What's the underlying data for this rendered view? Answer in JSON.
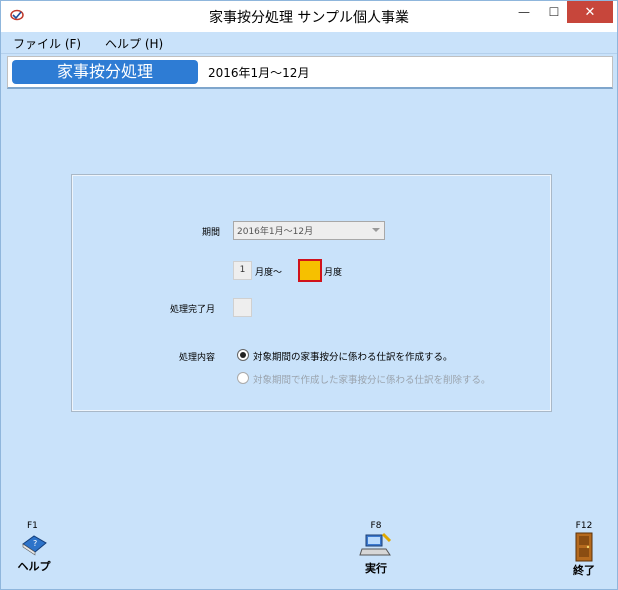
{
  "window": {
    "title": "家事按分処理 サンプル個人事業",
    "controls": {
      "minimize": "—",
      "maximize": "☐",
      "close": "✕"
    }
  },
  "menu": {
    "file": "ファイル (F)",
    "help": "ヘルプ (H)"
  },
  "header": {
    "title": "家事按分処理",
    "period": "2016年1月～12月"
  },
  "form": {
    "period_label": "期間",
    "period_value": "2016年1月～12月",
    "from_month_value": "1",
    "from_month_suffix": "月度～",
    "to_month_suffix": "月度",
    "completed_label": "処理完了月",
    "content_label": "処理内容",
    "option_create": "対象期間の家事按分に係わる仕訳を作成する。",
    "option_delete": "対象期間で作成した家事按分に係わる仕訳を削除する。"
  },
  "footer": {
    "help": {
      "key": "F1",
      "label": "ヘルプ"
    },
    "run": {
      "key": "F8",
      "label": "実行"
    },
    "exit": {
      "key": "F12",
      "label": "終了"
    }
  }
}
